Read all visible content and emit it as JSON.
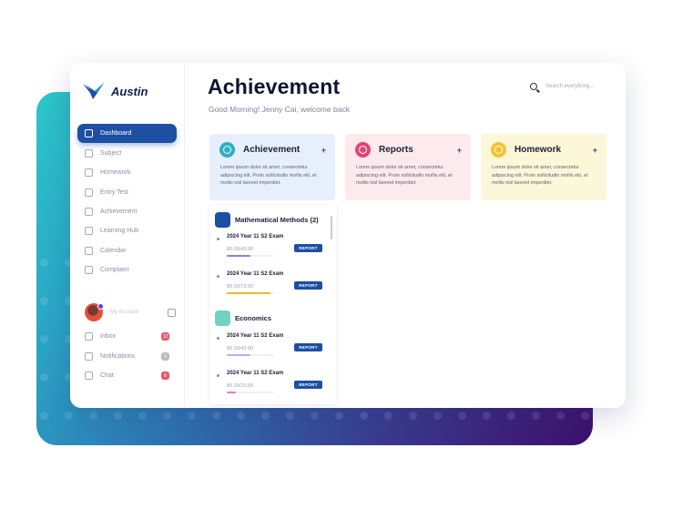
{
  "brand": {
    "name": "Austin"
  },
  "nav": [
    {
      "label": "Dashboard",
      "active": true
    },
    {
      "label": "Subject"
    },
    {
      "label": "Homework"
    },
    {
      "label": "Entry Test"
    },
    {
      "label": "Achievement"
    },
    {
      "label": "Learning Hub"
    },
    {
      "label": "Calendar"
    },
    {
      "label": "Complaint"
    }
  ],
  "account": {
    "label": "My Account"
  },
  "messages": [
    {
      "label": "Inbox",
      "count": "12",
      "color": "#e25a6b"
    },
    {
      "label": "Notifications",
      "count": "6",
      "color": "#b7bac6"
    },
    {
      "label": "Chat",
      "count": "6",
      "color": "#e25a6b"
    }
  ],
  "header": {
    "title": "Achievement",
    "greeting": "Good Morning! Jenny Cai,  welcome back",
    "search_placeholder": "Search everything..."
  },
  "cards": [
    {
      "title": "Achievement",
      "plus": "+",
      "text": "Lorem ipsum dolor sit amet, consectetur adipiscing elit. Proin sollicitudin mollis elit, et mollis nisl laoreet imperdiet.",
      "bg": "#e7effd",
      "icon_color": "#2db0c0"
    },
    {
      "title": "Reports",
      "plus": "+",
      "text": "Lorem ipsum dolor sit amet, consectetur adipiscing elit. Proin sollicitudin mollis elit, et mollis nisl laoreet imperdiet.",
      "bg": "#fdeaec",
      "icon_color": "#e0447a"
    },
    {
      "title": "Homework",
      "plus": "+",
      "text": "Lorem ipsum dolor sit amet, consectetur adipiscing elit. Proin sollicitudin mollis elit, et mollis nisl laoreet imperdiet.",
      "bg": "#fdf7d9",
      "icon_color": "#f4c430"
    }
  ],
  "subjects": [
    {
      "name": "Mathematical Methods (2)",
      "icon_color": "#1d4fa3",
      "exams": [
        {
          "title": "2024 Year 11    S2 Exam",
          "score": "80.00/43.00",
          "progress": 0.5,
          "bar_color": "#8e7cf0",
          "action": "REPORT"
        },
        {
          "title": "2024 Year 11    S2 Exam",
          "score": "80.00/73.00",
          "progress": 0.92,
          "bar_color": "#e7b92c",
          "action": "REPORT"
        }
      ]
    },
    {
      "name": "Economics",
      "icon_color": "#6fd3c0",
      "exams": [
        {
          "title": "2024 Year 11    S2 Exam",
          "score": "80.00/43.00",
          "progress": 0.5,
          "bar_color": "#aeb5f2",
          "action": "REPORT"
        },
        {
          "title": "2024 Year 11    S2 Exam",
          "score": "80.00/23.00",
          "progress": 0.2,
          "bar_color": "#ee7aa3",
          "action": "REPORT"
        }
      ]
    }
  ]
}
